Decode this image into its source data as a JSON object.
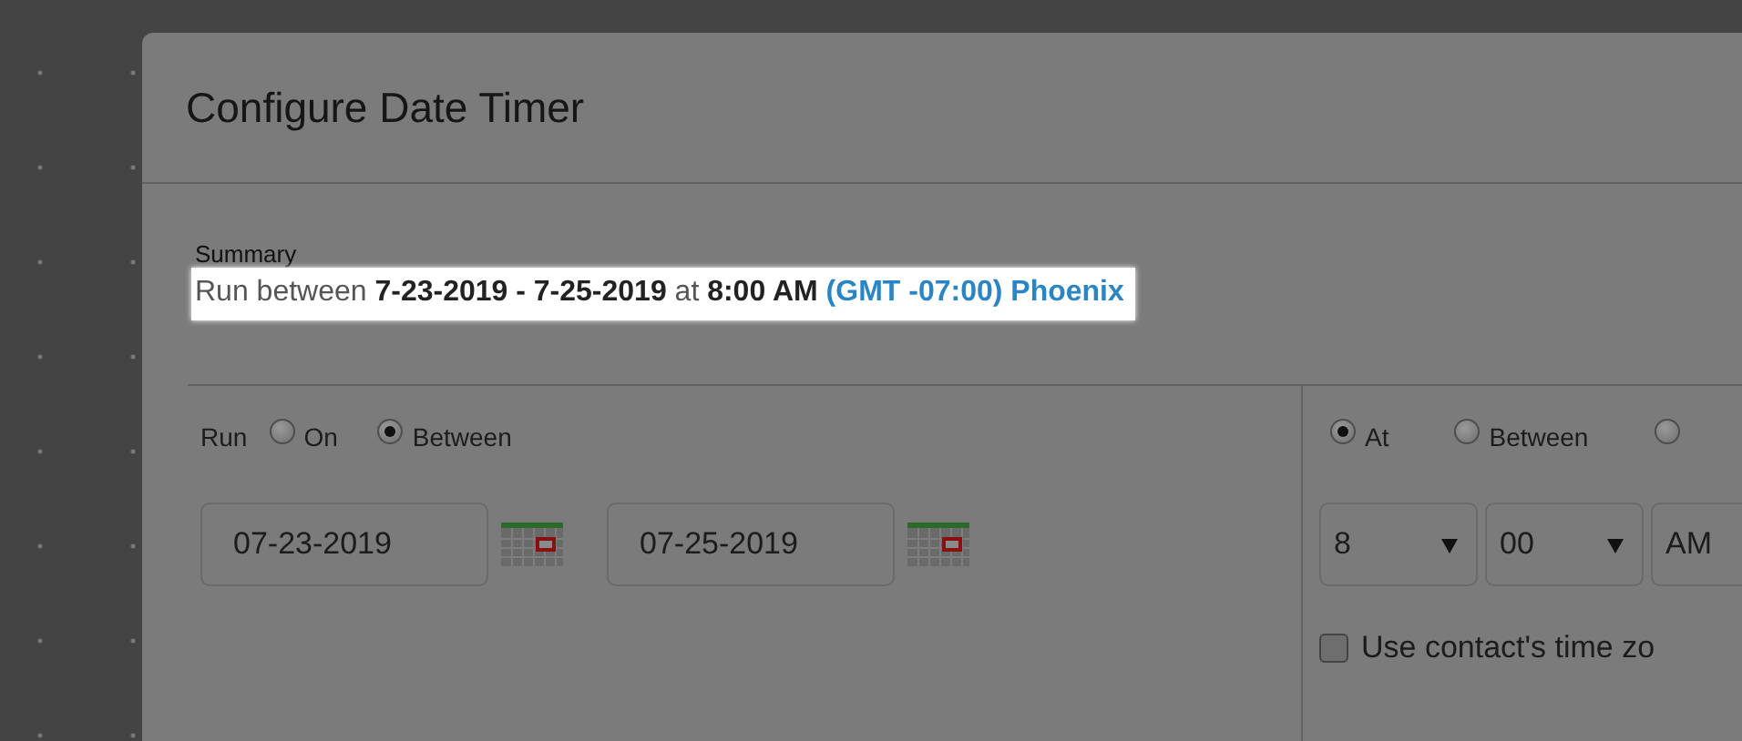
{
  "dialog": {
    "title": "Configure Date Timer",
    "summary": {
      "label": "Summary",
      "text": "Run between **7-23-2019 - 7-25-2019** at **8:00 AM**",
      "timezone": "(GMT -07:00) Phoenix"
    },
    "date": {
      "label": "Run",
      "options": [
        {
          "label": "On",
          "selected": false
        },
        {
          "label": "Between",
          "selected": true
        }
      ],
      "fields": [
        {
          "value": "07-23-2019"
        },
        {
          "value": "07-25-2019"
        }
      ]
    },
    "time": {
      "options": [
        {
          "label": "At",
          "selected": true
        },
        {
          "label": "Between",
          "selected": false
        },
        {
          "selected": false
        }
      ],
      "selects": [
        {
          "value": "8"
        },
        {
          "value": "00"
        },
        {
          "value": "AM"
        }
      ],
      "use_contact_time_zone": {
        "label": "Use contact's time zo",
        "checked": false
      }
    }
  }
}
